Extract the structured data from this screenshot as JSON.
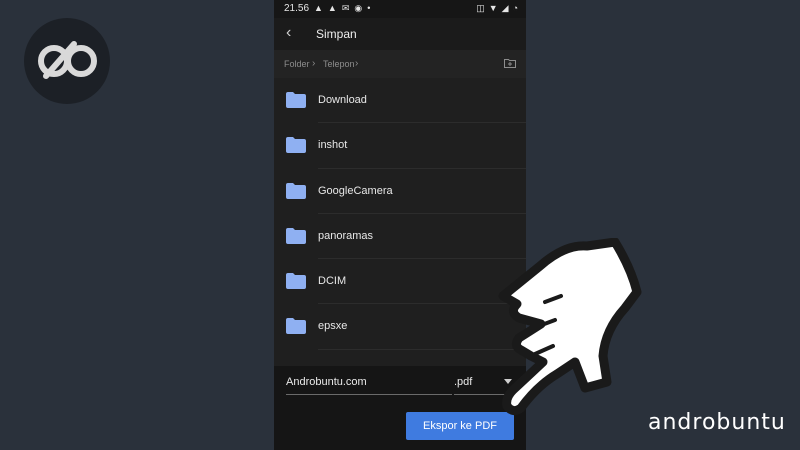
{
  "status": {
    "time": "21.56",
    "left_icons": [
      "notification-icon",
      "notification-icon",
      "mail-icon",
      "chat-icon",
      "dot-icon"
    ],
    "right_icons": [
      "vibrate-icon",
      "wifi-icon",
      "signal-icon",
      "battery-icon"
    ]
  },
  "app": {
    "title": "Simpan",
    "breadcrumbs": [
      "Folder",
      "Telepon"
    ]
  },
  "folders": [
    "Download",
    "inshot",
    "GoogleCamera",
    "panoramas",
    "DCIM",
    "epsxe"
  ],
  "save": {
    "filename": "Androbuntu.com",
    "extension": ".pdf",
    "export_label": "Ekspor ke PDF"
  },
  "brand": {
    "name": "androbuntu"
  },
  "colors": {
    "accent": "#3f7be0",
    "folder": "#8fb0f2",
    "background": "#2a313b"
  }
}
